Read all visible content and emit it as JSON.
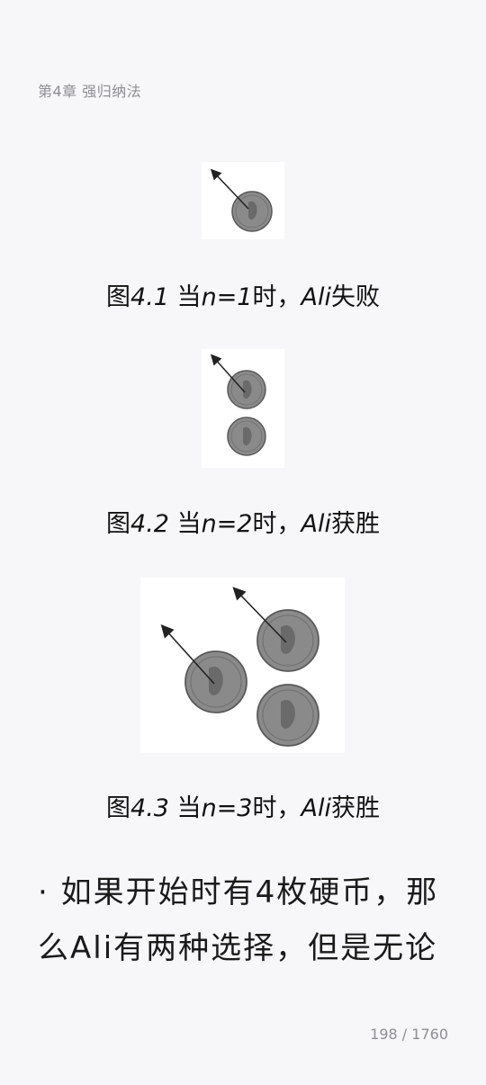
{
  "header": {
    "chapter": "第4章 强归纳法"
  },
  "figures": [
    {
      "caption_prefix": "图",
      "caption_num": "4.1",
      "caption_mid": " 当",
      "caption_var": "n",
      "caption_eq": "=1",
      "caption_rest": "时，",
      "caption_name": "Ali",
      "caption_end": "失败"
    },
    {
      "caption_prefix": "图",
      "caption_num": "4.2",
      "caption_mid": " 当",
      "caption_var": "n",
      "caption_eq": "=2",
      "caption_rest": "时，",
      "caption_name": "Ali",
      "caption_end": "获胜"
    },
    {
      "caption_prefix": "图",
      "caption_num": "4.3",
      "caption_mid": " 当",
      "caption_var": "n",
      "caption_eq": "=3",
      "caption_rest": "时，",
      "caption_name": "Ali",
      "caption_end": "获胜"
    }
  ],
  "body": {
    "line1": "· 如果开始时有4枚硬币，那",
    "line2": "么Ali有两种选择，但是无论"
  },
  "footer": {
    "page_indicator": "198 / 1760"
  },
  "colors": {
    "background": "#f7f7f9",
    "coin_fill": "#8a8a8a",
    "coin_edge": "#5a5a5a",
    "arrow": "#222222"
  },
  "icons": [
    "coin-icon",
    "arrow-icon"
  ]
}
